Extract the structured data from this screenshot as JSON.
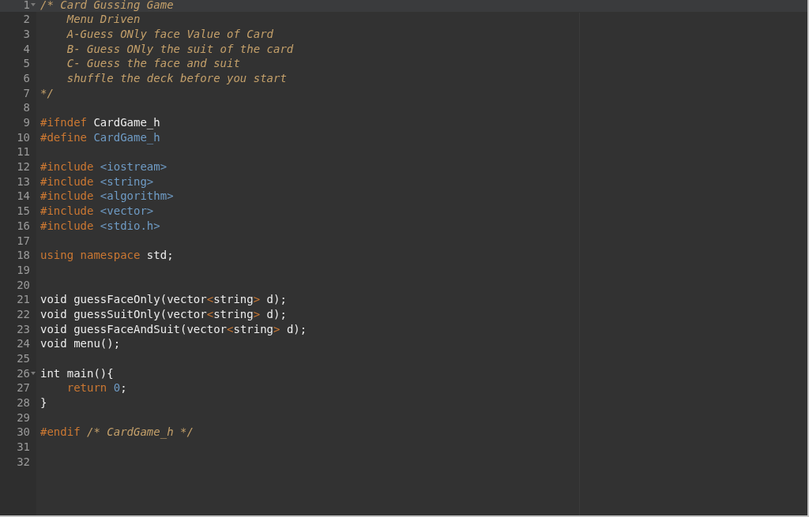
{
  "editor": {
    "lines": [
      {
        "number": "1",
        "active": true,
        "foldable": true,
        "tokens": [
          {
            "kind": "comment",
            "text": "/* Card Gussing Game"
          }
        ]
      },
      {
        "number": "2",
        "active": false,
        "foldable": false,
        "tokens": [
          {
            "kind": "comment",
            "text": "    Menu Driven"
          }
        ]
      },
      {
        "number": "3",
        "active": false,
        "foldable": false,
        "tokens": [
          {
            "kind": "comment",
            "text": "    A-Guess ONly face Value of Card"
          }
        ]
      },
      {
        "number": "4",
        "active": false,
        "foldable": false,
        "tokens": [
          {
            "kind": "comment",
            "text": "    B- Guess ONly the suit of the card"
          }
        ]
      },
      {
        "number": "5",
        "active": false,
        "foldable": false,
        "tokens": [
          {
            "kind": "comment",
            "text": "    C- Guess the face and suit"
          }
        ]
      },
      {
        "number": "6",
        "active": false,
        "foldable": false,
        "tokens": [
          {
            "kind": "comment",
            "text": "    shuffle the deck before you start"
          }
        ]
      },
      {
        "number": "7",
        "active": false,
        "foldable": false,
        "tokens": [
          {
            "kind": "comment",
            "text": "*/"
          }
        ]
      },
      {
        "number": "8",
        "active": false,
        "foldable": false
      },
      {
        "number": "9",
        "active": false,
        "foldable": false,
        "tokens": [
          {
            "kind": "keyword",
            "text": "#ifndef"
          },
          {
            "kind": "plain",
            "text": " CardGame_h"
          }
        ]
      },
      {
        "number": "10",
        "active": false,
        "foldable": false,
        "tokens": [
          {
            "kind": "keyword",
            "text": "#define"
          },
          {
            "kind": "constant",
            "text": " CardGame_h"
          }
        ]
      },
      {
        "number": "11",
        "active": false,
        "foldable": false
      },
      {
        "number": "12",
        "active": false,
        "foldable": false,
        "tokens": [
          {
            "kind": "keyword",
            "text": "#include"
          },
          {
            "kind": "constant",
            "text": " <iostream>"
          }
        ]
      },
      {
        "number": "13",
        "active": false,
        "foldable": false,
        "tokens": [
          {
            "kind": "keyword",
            "text": "#include"
          },
          {
            "kind": "constant",
            "text": " <string>"
          }
        ]
      },
      {
        "number": "14",
        "active": false,
        "foldable": false,
        "tokens": [
          {
            "kind": "keyword",
            "text": "#include"
          },
          {
            "kind": "constant",
            "text": " <algorithm>"
          }
        ]
      },
      {
        "number": "15",
        "active": false,
        "foldable": false,
        "tokens": [
          {
            "kind": "keyword",
            "text": "#include"
          },
          {
            "kind": "constant",
            "text": " <vector>"
          }
        ]
      },
      {
        "number": "16",
        "active": false,
        "foldable": false,
        "tokens": [
          {
            "kind": "keyword",
            "text": "#include"
          },
          {
            "kind": "constant",
            "text": " <stdio.h>"
          }
        ]
      },
      {
        "number": "17",
        "active": false,
        "foldable": false
      },
      {
        "number": "18",
        "active": false,
        "foldable": false,
        "tokens": [
          {
            "kind": "keyword",
            "text": "using namespace"
          },
          {
            "kind": "plain",
            "text": " std;"
          }
        ]
      },
      {
        "number": "19",
        "active": false,
        "foldable": false
      },
      {
        "number": "20",
        "active": false,
        "foldable": false
      },
      {
        "number": "21",
        "active": false,
        "foldable": false,
        "tokens": [
          {
            "kind": "plain",
            "text": "void guessFaceOnly(vector"
          },
          {
            "kind": "keyword",
            "text": "<"
          },
          {
            "kind": "plain",
            "text": "string"
          },
          {
            "kind": "keyword",
            "text": ">"
          },
          {
            "kind": "plain",
            "text": " d);"
          }
        ]
      },
      {
        "number": "22",
        "active": false,
        "foldable": false,
        "tokens": [
          {
            "kind": "plain",
            "text": "void guessSuitOnly(vector"
          },
          {
            "kind": "keyword",
            "text": "<"
          },
          {
            "kind": "plain",
            "text": "string"
          },
          {
            "kind": "keyword",
            "text": ">"
          },
          {
            "kind": "plain",
            "text": " d);"
          }
        ]
      },
      {
        "number": "23",
        "active": false,
        "foldable": false,
        "tokens": [
          {
            "kind": "plain",
            "text": "void guessFaceAndSuit(vector"
          },
          {
            "kind": "keyword",
            "text": "<"
          },
          {
            "kind": "plain",
            "text": "string"
          },
          {
            "kind": "keyword",
            "text": ">"
          },
          {
            "kind": "plain",
            "text": " d);"
          }
        ]
      },
      {
        "number": "24",
        "active": false,
        "foldable": false,
        "tokens": [
          {
            "kind": "plain",
            "text": "void menu();"
          }
        ]
      },
      {
        "number": "25",
        "active": false,
        "foldable": false
      },
      {
        "number": "26",
        "active": false,
        "foldable": true,
        "tokens": [
          {
            "kind": "plain",
            "text": "int main(){"
          }
        ]
      },
      {
        "number": "27",
        "active": false,
        "foldable": false,
        "tokens": [
          {
            "kind": "keyword",
            "text": "    return"
          },
          {
            "kind": "constant",
            "text": " 0"
          },
          {
            "kind": "plain",
            "text": ";"
          }
        ]
      },
      {
        "number": "28",
        "active": false,
        "foldable": false,
        "tokens": [
          {
            "kind": "plain",
            "text": "}"
          }
        ]
      },
      {
        "number": "29",
        "active": false,
        "foldable": false
      },
      {
        "number": "30",
        "active": false,
        "foldable": false,
        "tokens": [
          {
            "kind": "keyword",
            "text": "#endif"
          },
          {
            "kind": "comment",
            "text": " /* CardGame_h */"
          }
        ]
      },
      {
        "number": "31",
        "active": false,
        "foldable": false
      },
      {
        "number": "32",
        "active": false,
        "foldable": false
      }
    ]
  }
}
